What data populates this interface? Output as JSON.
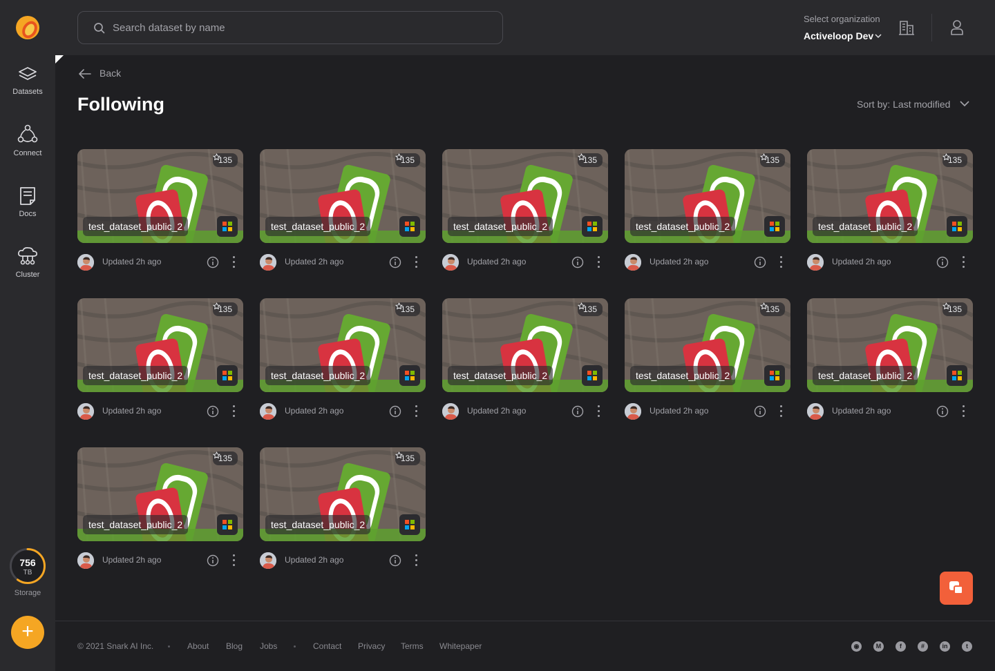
{
  "sidebar": {
    "items": [
      {
        "label": "Datasets"
      },
      {
        "label": "Connect"
      },
      {
        "label": "Docs"
      },
      {
        "label": "Cluster"
      }
    ],
    "storage": {
      "value": "756",
      "unit": "TB",
      "label": "Storage",
      "fill_fraction": 0.6
    },
    "accent": "#f5a623"
  },
  "header": {
    "search_placeholder": "Search dataset by name",
    "org_label": "Select organization",
    "org_name": "Activeloop Dev"
  },
  "page": {
    "back_label": "Back",
    "title": "Following",
    "sort_label": "Sort by: Last modified"
  },
  "datasets": [
    {
      "name": "test_dataset_public_2",
      "stars": "135",
      "updated": "Updated 2h ago"
    },
    {
      "name": "test_dataset_public_2",
      "stars": "135",
      "updated": "Updated 2h ago"
    },
    {
      "name": "test_dataset_public_2",
      "stars": "135",
      "updated": "Updated 2h ago"
    },
    {
      "name": "test_dataset_public_2",
      "stars": "135",
      "updated": "Updated 2h ago"
    },
    {
      "name": "test_dataset_public_2",
      "stars": "135",
      "updated": "Updated 2h ago"
    },
    {
      "name": "test_dataset_public_2",
      "stars": "135",
      "updated": "Updated 2h ago"
    },
    {
      "name": "test_dataset_public_2",
      "stars": "135",
      "updated": "Updated 2h ago"
    },
    {
      "name": "test_dataset_public_2",
      "stars": "135",
      "updated": "Updated 2h ago"
    },
    {
      "name": "test_dataset_public_2",
      "stars": "135",
      "updated": "Updated 2h ago"
    },
    {
      "name": "test_dataset_public_2",
      "stars": "135",
      "updated": "Updated 2h ago"
    },
    {
      "name": "test_dataset_public_2",
      "stars": "135",
      "updated": "Updated 2h ago"
    },
    {
      "name": "test_dataset_public_2",
      "stars": "135",
      "updated": "Updated 2h ago"
    }
  ],
  "footer": {
    "copyright": "© 2021 Snark AI Inc.",
    "links": [
      "About",
      "Blog",
      "Jobs",
      "Contact",
      "Privacy",
      "Terms",
      "Whitepaper"
    ],
    "social_icons": [
      "github-icon",
      "medium-icon",
      "facebook-icon",
      "slack-icon",
      "linkedin-icon",
      "twitter-icon"
    ]
  },
  "colors": {
    "background": "#1f1f22",
    "panel": "#2a2a2d",
    "chat_button": "#f2603a"
  }
}
